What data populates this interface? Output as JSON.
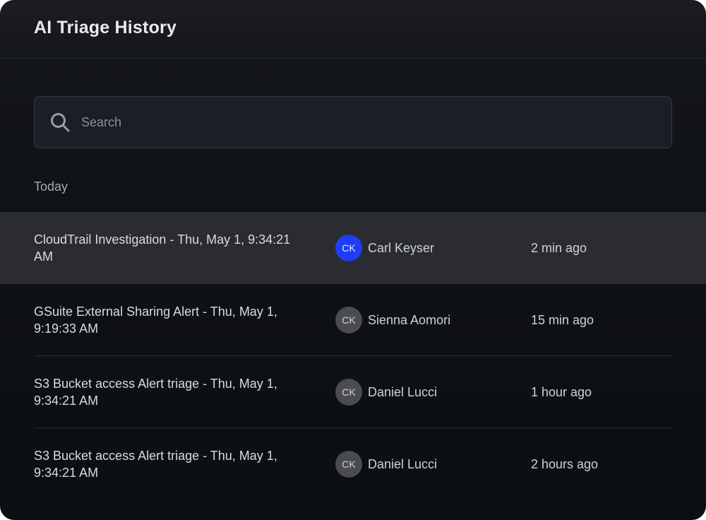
{
  "header": {
    "title": "AI Triage History"
  },
  "search": {
    "placeholder": "Search",
    "icon": "search-icon"
  },
  "section": {
    "label": "Today"
  },
  "colors": {
    "active_avatar": "#1f3df5",
    "row_selected": "#2a2c32"
  },
  "items": [
    {
      "name": "CloudTrail Investigation - Thu, May 1, 9:34:21 AM",
      "initials": "CK",
      "owner": "Carl Keyser",
      "time": "2 min ago",
      "selected": true
    },
    {
      "name": "GSuite External Sharing Alert - Thu, May 1, 9:19:33 AM",
      "initials": "CK",
      "owner": "Sienna Aomori",
      "time": "15 min ago",
      "selected": false
    },
    {
      "name": "S3 Bucket access Alert triage - Thu, May 1, 9:34:21 AM",
      "initials": "CK",
      "owner": "Daniel Lucci",
      "time": "1 hour ago",
      "selected": false
    },
    {
      "name": "S3 Bucket access Alert triage - Thu, May 1, 9:34:21 AM",
      "initials": "CK",
      "owner": "Daniel Lucci",
      "time": "2 hours ago",
      "selected": false
    }
  ]
}
